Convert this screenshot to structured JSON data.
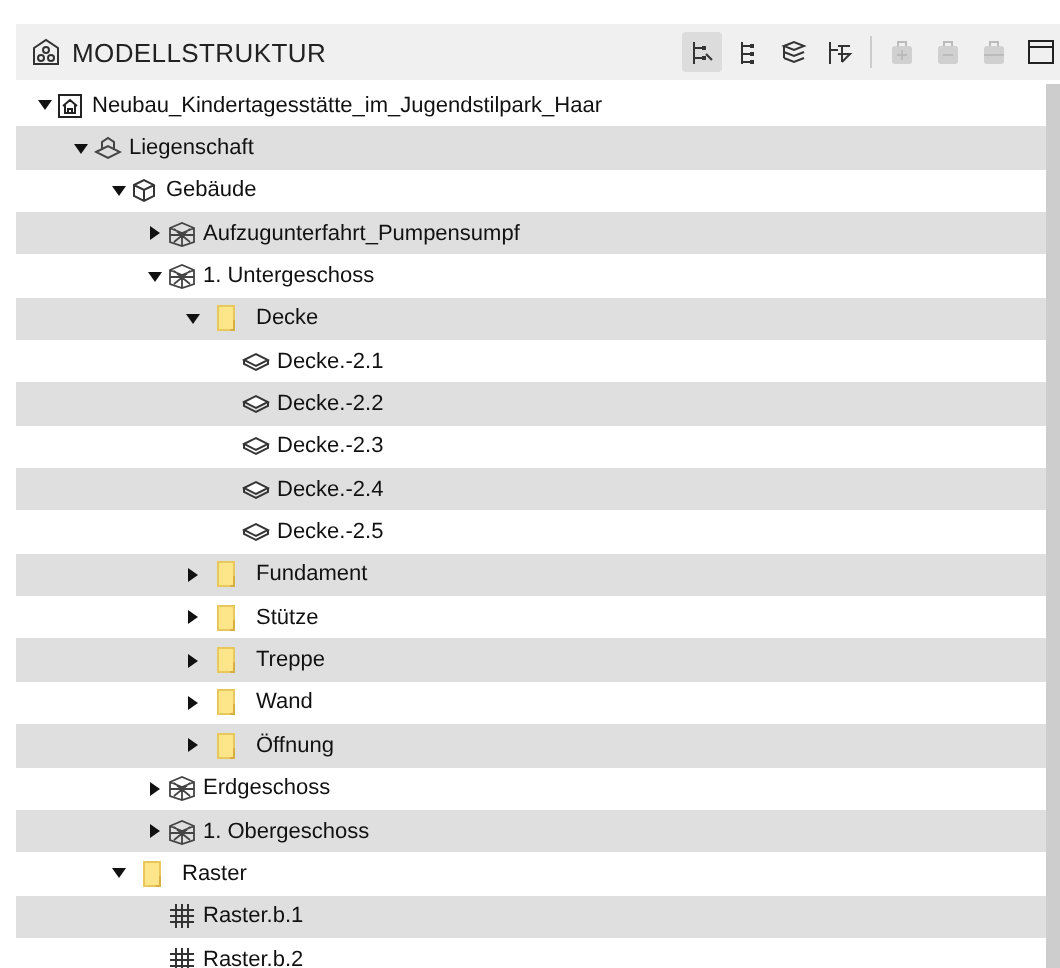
{
  "panel": {
    "title": "MODELLSTRUKTUR"
  },
  "toolbar": [
    {
      "kind": "tree",
      "selected": true,
      "disabled": false
    },
    {
      "kind": "hierarchy",
      "selected": false,
      "disabled": false
    },
    {
      "kind": "layers",
      "selected": false,
      "disabled": false
    },
    {
      "kind": "branch",
      "selected": false,
      "disabled": false
    },
    {
      "kind": "bag-add",
      "selected": false,
      "disabled": true
    },
    {
      "kind": "bag-remove",
      "selected": false,
      "disabled": true
    },
    {
      "kind": "bag",
      "selected": false,
      "disabled": true
    },
    {
      "kind": "window",
      "selected": false,
      "disabled": false
    }
  ],
  "tree": [
    {
      "label": "Neubau_Kindertagesstätte_im_Jugendstilpark_Haar",
      "kind": "project",
      "expanded": true,
      "children": [
        {
          "label": "Liegenschaft",
          "kind": "site",
          "expanded": true,
          "children": [
            {
              "label": "Gebäude",
              "kind": "building",
              "expanded": true,
              "children": [
                {
                  "label": "Aufzugunterfahrt_Pumpensumpf",
                  "kind": "storey",
                  "expanded": false
                },
                {
                  "label": "1. Untergeschoss",
                  "kind": "storey",
                  "expanded": true,
                  "children": [
                    {
                      "label": "Decke",
                      "kind": "folder",
                      "expanded": true,
                      "children": [
                        {
                          "label": "Decke.-2.1",
                          "kind": "slab"
                        },
                        {
                          "label": "Decke.-2.2",
                          "kind": "slab"
                        },
                        {
                          "label": "Decke.-2.3",
                          "kind": "slab"
                        },
                        {
                          "label": "Decke.-2.4",
                          "kind": "slab"
                        },
                        {
                          "label": "Decke.-2.5",
                          "kind": "slab"
                        }
                      ]
                    },
                    {
                      "label": "Fundament",
                      "kind": "folder",
                      "expanded": false
                    },
                    {
                      "label": "Stütze",
                      "kind": "folder",
                      "expanded": false
                    },
                    {
                      "label": "Treppe",
                      "kind": "folder",
                      "expanded": false
                    },
                    {
                      "label": "Wand",
                      "kind": "folder",
                      "expanded": false
                    },
                    {
                      "label": "Öffnung",
                      "kind": "folder",
                      "expanded": false
                    }
                  ]
                },
                {
                  "label": "Erdgeschoss",
                  "kind": "storey",
                  "expanded": false
                },
                {
                  "label": "1. Obergeschoss",
                  "kind": "storey",
                  "expanded": false
                }
              ]
            },
            {
              "label": "Raster",
              "kind": "folder",
              "expanded": true,
              "children": [
                {
                  "label": "Raster.b.1",
                  "kind": "grid"
                },
                {
                  "label": "Raster.b.2",
                  "kind": "grid"
                }
              ]
            }
          ]
        }
      ]
    }
  ]
}
